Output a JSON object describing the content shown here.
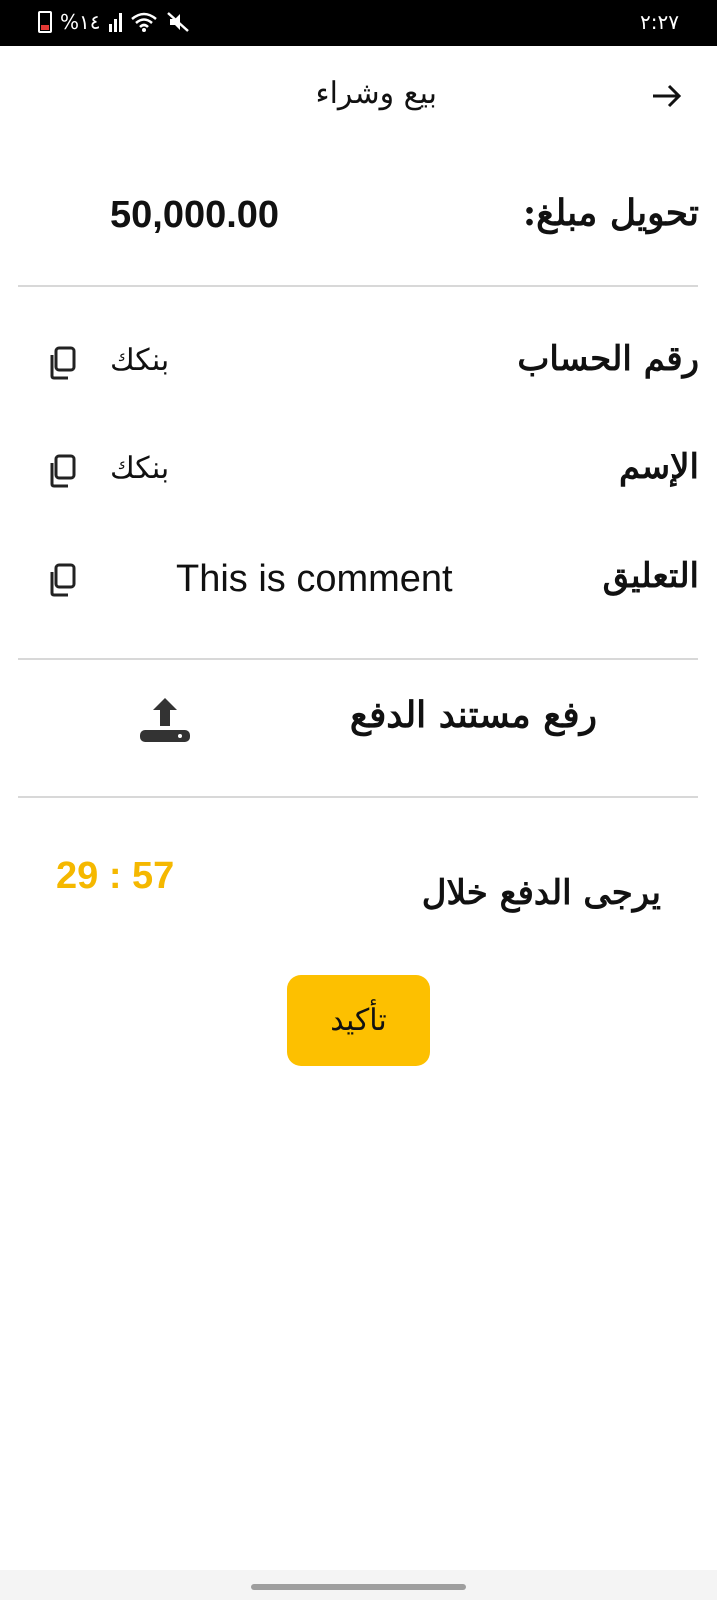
{
  "status_bar": {
    "time": "٢:٢٧",
    "battery_text": "%١٤",
    "icons": [
      "battery-icon",
      "signal-icon",
      "wifi-icon",
      "mute-icon"
    ]
  },
  "header": {
    "title": "بيع وشراء",
    "back_icon": "arrow-right-icon"
  },
  "transfer": {
    "label": "تحويل مبلغ:",
    "amount": "50,000.00"
  },
  "details": [
    {
      "label": "رقم الحساب",
      "value": "بنكك",
      "icon": "copy-icon"
    },
    {
      "label": "الإسم",
      "value": "بنكك",
      "icon": "copy-icon"
    },
    {
      "label": "التعليق",
      "value": "This is comment",
      "icon": "copy-icon"
    }
  ],
  "upload": {
    "label": "رفع مستند الدفع",
    "icon": "upload-icon"
  },
  "timer": {
    "label": "يرجى الدفع خلال",
    "value": "29 : 57",
    "color": "#f5b800"
  },
  "confirm_button": {
    "label": "تأكيد",
    "color": "#fdc000"
  }
}
